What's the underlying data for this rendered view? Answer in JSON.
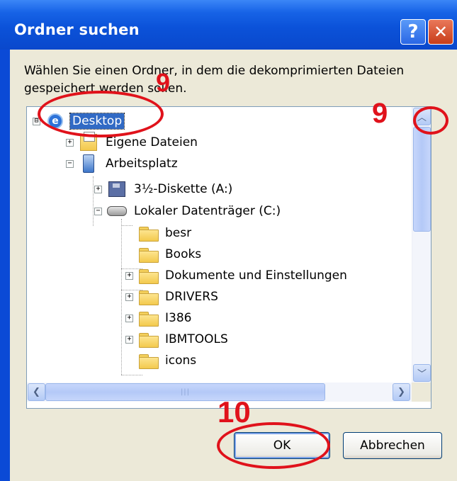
{
  "window": {
    "title": "Ordner suchen",
    "help_glyph": "?",
    "close_glyph": "✕"
  },
  "prompt": "Wählen Sie einen Ordner, in dem die dekomprimierten Dateien gespeichert werden sollen.",
  "tree": {
    "items": [
      {
        "label": "Desktop",
        "expander": "⊟",
        "icon": "desktop-icon",
        "selected": true
      },
      {
        "label": "Eigene Dateien",
        "expander": "+",
        "icon": "my-documents-icon"
      },
      {
        "label": "Arbeitsplatz",
        "expander": "−",
        "icon": "my-computer-icon"
      },
      {
        "label": "3½-Diskette (A:)",
        "expander": "+",
        "icon": "floppy-drive-icon"
      },
      {
        "label": "Lokaler Datenträger (C:)",
        "expander": "−",
        "icon": "hard-drive-icon"
      },
      {
        "label": "besr",
        "expander": "",
        "icon": "folder-icon"
      },
      {
        "label": "Books",
        "expander": "",
        "icon": "folder-icon"
      },
      {
        "label": "Dokumente und Einstellungen",
        "expander": "+",
        "icon": "folder-icon"
      },
      {
        "label": "DRIVERS",
        "expander": "+",
        "icon": "folder-icon"
      },
      {
        "label": "I386",
        "expander": "+",
        "icon": "folder-icon"
      },
      {
        "label": "IBMTOOLS",
        "expander": "+",
        "icon": "folder-icon"
      },
      {
        "label": "icons",
        "expander": "",
        "icon": "folder-icon"
      }
    ]
  },
  "scrollbar": {
    "up_glyph": "︿",
    "down_glyph": "﹀",
    "left_glyph": "❮",
    "right_glyph": "❯",
    "grip": "|||"
  },
  "buttons": {
    "ok_label": "OK",
    "cancel_label": "Abbrechen"
  },
  "annotations": {
    "step_9_desktop": "9",
    "step_9_scroll": "9",
    "step_10_ok": "10",
    "color": "#e0121b"
  }
}
